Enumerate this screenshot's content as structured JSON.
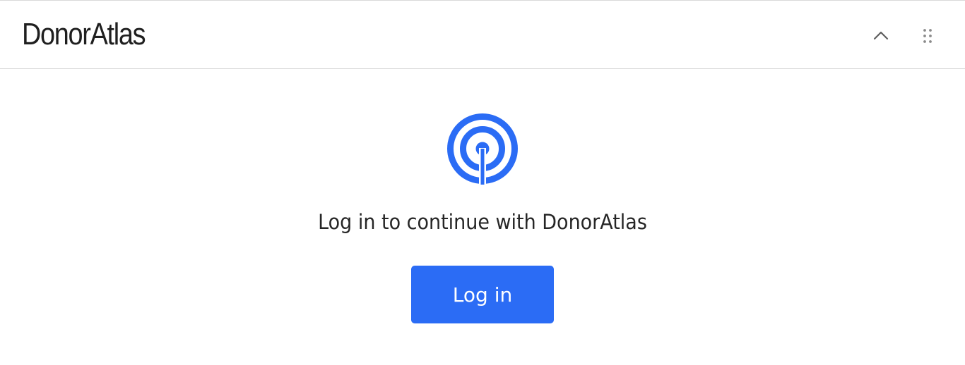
{
  "header": {
    "title": "DonorAtlas",
    "collapse_icon": "chevron-up-icon",
    "drag_icon": "drag-handle-icon"
  },
  "main": {
    "logo_icon": "broadcast-target-icon",
    "prompt": "Log in to continue with DonorAtlas",
    "login_label": "Log in"
  },
  "colors": {
    "accent": "#2b6cf5",
    "text": "#262626",
    "divider": "#d6d6d6",
    "icon_gray": "#5f5f5f"
  }
}
